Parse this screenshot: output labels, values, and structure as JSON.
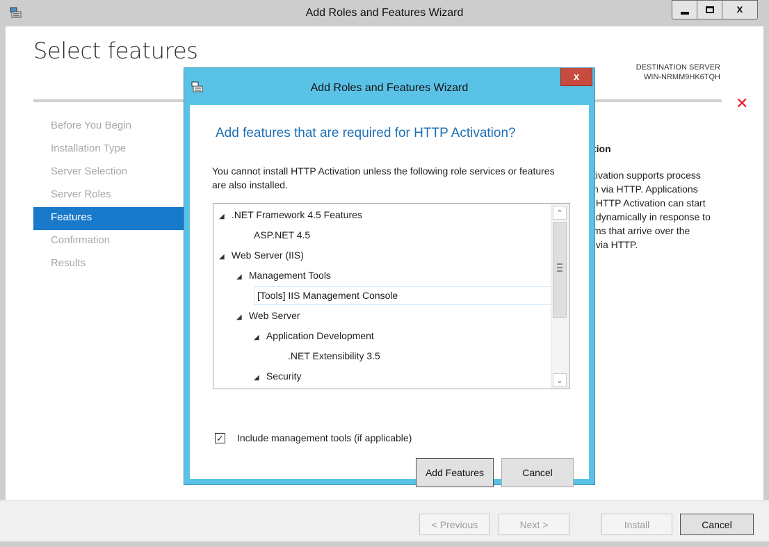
{
  "window": {
    "title": "Add Roles and Features Wizard",
    "page_title": "Select features",
    "destination_label": "DESTINATION SERVER",
    "destination_server": "WIN-NRMM9HK6TQH",
    "error_glyph": "✕",
    "close_glyph": "x"
  },
  "nav": {
    "items": [
      {
        "label": "Before You Begin",
        "active": false
      },
      {
        "label": "Installation Type",
        "active": false
      },
      {
        "label": "Server Selection",
        "active": false
      },
      {
        "label": "Server Roles",
        "active": false
      },
      {
        "label": "Features",
        "active": true
      },
      {
        "label": "Confirmation",
        "active": false
      },
      {
        "label": "Results",
        "active": false
      }
    ]
  },
  "description": {
    "title": "tion",
    "lines": [
      "tivation supports process",
      "n via HTTP. Applications",
      " HTTP Activation can start",
      " dynamically in response to",
      "ms that arrive over the",
      " via HTTP."
    ]
  },
  "footer": {
    "previous_label": "< Previous",
    "next_label": "Next >",
    "install_label": "Install",
    "cancel_label": "Cancel"
  },
  "dialog": {
    "title": "Add Roles and Features Wizard",
    "close_glyph": "x",
    "heading": "Add features that are required for HTTP Activation?",
    "body": "You cannot install HTTP Activation unless the following role services or features are also installed.",
    "tree": [
      {
        "label": ".NET Framework 4.5 Features",
        "expandable": true
      },
      {
        "label": "ASP.NET 4.5",
        "expandable": false
      },
      {
        "label": "Web Server (IIS)",
        "expandable": true
      },
      {
        "label": "Management Tools",
        "expandable": true
      },
      {
        "label": "[Tools] IIS Management Console",
        "expandable": false,
        "selected": true
      },
      {
        "label": "Web Server",
        "expandable": true
      },
      {
        "label": "Application Development",
        "expandable": true
      },
      {
        "label": ".NET Extensibility 3.5",
        "expandable": false
      },
      {
        "label": "Security",
        "expandable": true
      }
    ],
    "include_mgmt_label": "Include management tools (if applicable)",
    "include_mgmt_checked": true,
    "add_features_label": "Add Features",
    "cancel_label": "Cancel"
  },
  "icons": {
    "expand": "◢",
    "check": "✓",
    "scroll_up": "⌃",
    "scroll_down": "⌄"
  },
  "colors": {
    "accent": "#1979ca",
    "dialog_frame": "#5bc2e7",
    "heading": "#1f70b5",
    "error": "#e81123",
    "close_button": "#c74b3e"
  }
}
